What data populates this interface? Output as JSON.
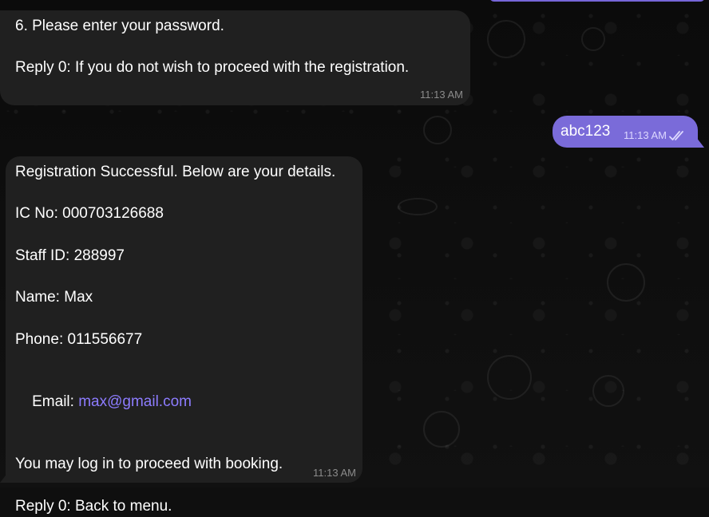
{
  "colors": {
    "background": "#0f0f0f",
    "incoming_bubble": "#202020",
    "outgoing_bubble": "#7a6bd9",
    "link": "#8d7cff",
    "timestamp": "#8b8b8b"
  },
  "messages": {
    "password_prompt": {
      "lines": [
        "6. Please enter your password.",
        "Reply 0: If you do not wish to proceed with the registration."
      ],
      "time": "11:13 AM"
    },
    "user_reply": {
      "text": "abc123",
      "time": "11:13 AM",
      "status_icon": "double-check-icon"
    },
    "registration_result": {
      "line1": "Registration Successful. Below are your details.",
      "ic": "IC No: 000703126688",
      "staff_id": "Staff ID: 288997",
      "name": "Name: Max",
      "phone": "Phone: 011556677",
      "email_label": "Email: ",
      "email_link": "max@gmail.com",
      "login_note": "You may log in to proceed with booking.",
      "menu_reply": "Reply 0: Back to menu.",
      "time": "11:13 AM"
    }
  }
}
